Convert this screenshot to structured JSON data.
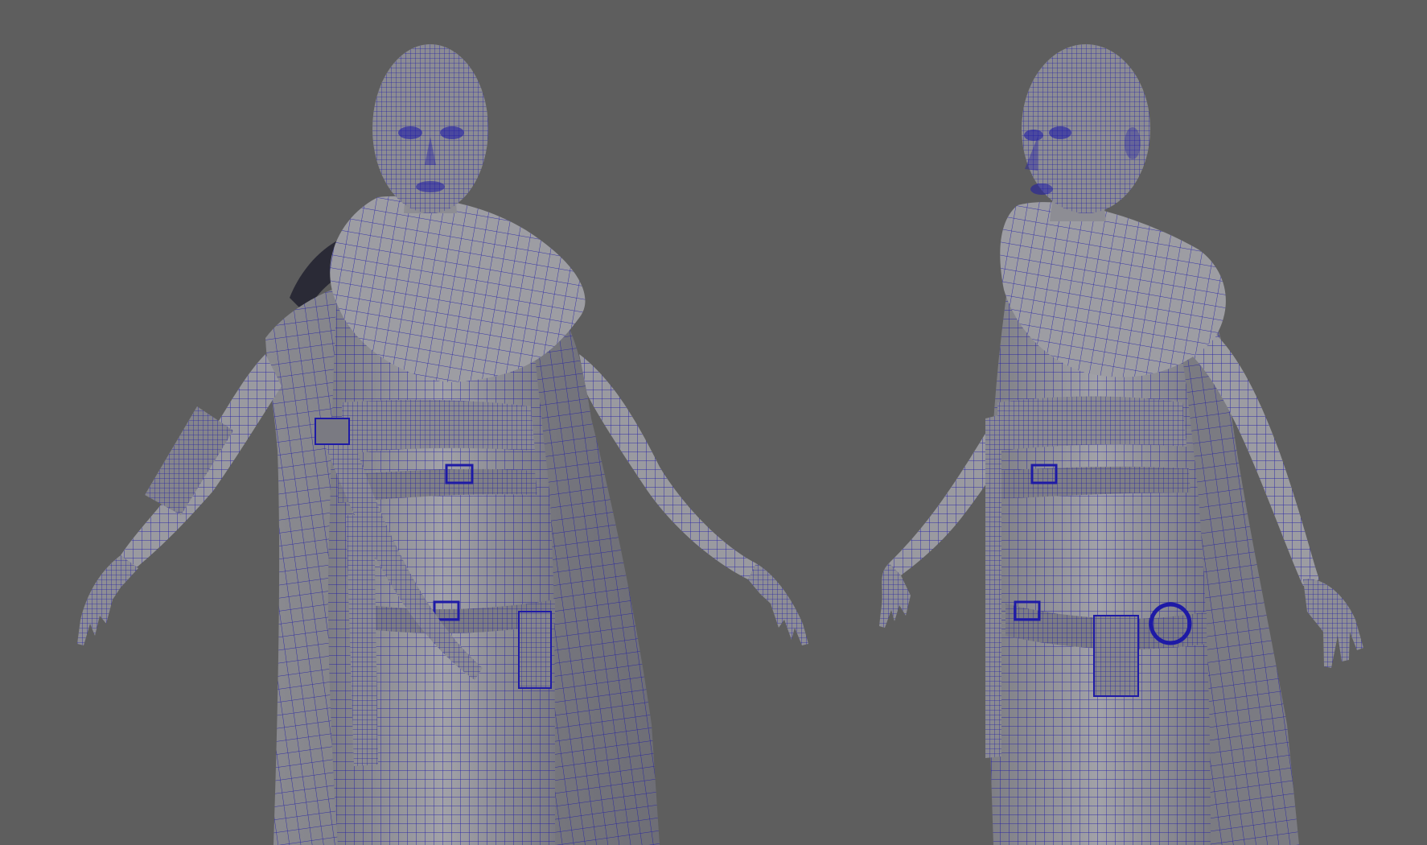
{
  "viewport": {
    "background_color": "#5e5e5e",
    "mesh_fill_color": "#8f8f93",
    "wireframe_color": "#1e1aa6",
    "shadow_color": "#2a2a36",
    "display_mode": "wireframe-on-shaded"
  },
  "models": [
    {
      "id": "character-front-view",
      "label": ""
    },
    {
      "id": "character-three-quarter-view",
      "label": ""
    }
  ]
}
